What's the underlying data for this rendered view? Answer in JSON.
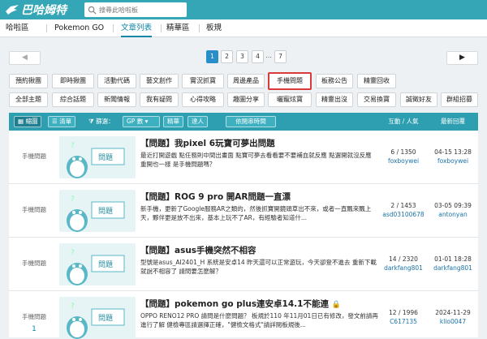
{
  "header": {
    "logo_text": "巴哈姆特",
    "search_placeholder": "搜尋此哈啦板"
  },
  "nav": {
    "tabs": [
      "哈啦區",
      "Pokemon GO",
      "文章列表",
      "精華區",
      "板規"
    ],
    "active_index": 2
  },
  "pager": {
    "prev_label": "◀",
    "next_label": "▶",
    "pages": [
      "1",
      "2",
      "3",
      "4",
      "7"
    ],
    "ellipsis": "…",
    "current": "1"
  },
  "categories_row1": [
    "預約揪團",
    "即時揪團",
    "活動代碼",
    "藝文創作",
    "實況抓寶",
    "周邊產品",
    "手機問題",
    "板務公告",
    "精靈回收"
  ],
  "categories_row2": [
    "全部主題",
    "綜合話題",
    "新聞情報",
    "我有疑問",
    "心得攻略",
    "趣圖分享",
    "曬寵炫寶",
    "精靈出沒",
    "交易換寶",
    "誠徵好友",
    "群組招募"
  ],
  "active_category": "手機問題",
  "listbar": {
    "thumb_view": "縮圖",
    "list_view": "清單",
    "filter_label": "篩選：",
    "gp_select": "GP 數",
    "featured": "精華",
    "hot": "達人",
    "sort": "依閱串時間",
    "col_stats": "互動 / 人氣",
    "col_latest": "最新回覆"
  },
  "posts": [
    {
      "category": "手機問題",
      "thumb_label": "問題",
      "title": "【問題】我pixel 6玩寶可夢出問題",
      "desc": "最近打開遊戲 點任務則中間出畫面 點寶可夢去看看要不要補血就反應 點選開就沒反應 重開也一樣 是手機問題嗎？",
      "stats": "6 / 1350",
      "stats_user": "foxboywei",
      "latest_time": "04-15 13:28",
      "latest_user": "foxboywei",
      "reply_count": ""
    },
    {
      "category": "手機問題",
      "thumb_label": "問題",
      "title": "【問題】ROG 9 pro 開AR問題一直漂",
      "desc": "新手機，更新了Google服務AR之類的，然後抓寶開鏡頭草出不來，或者一直飄來飄上天，夥伴更是放不出來，基本上玩不了AR，有經驗者知道什...",
      "stats": "2 / 1453",
      "stats_user": "asd03100678",
      "latest_time": "03-05 09:39",
      "latest_user": "antonyan",
      "reply_count": ""
    },
    {
      "category": "手機問題",
      "thumb_label": "問題",
      "title": "【問題】asus手機突然不相容",
      "desc": "型號是asus_AI2401_H 系統是安卓14 昨天還可以正常遊玩，今天卻登不進去 重新下載就說不相容了 請問要怎麼解？",
      "stats": "14 / 2320",
      "stats_user": "darkfang801",
      "latest_time": "01-01 18:28",
      "latest_user": "darkfang801",
      "reply_count": ""
    },
    {
      "category": "手機問題",
      "thumb_label": "問題",
      "title": "【問題】pokemon go plus連安卓14.1不能連",
      "desc": "OPPO RENO12 PRO 請問是什麼問題？ 板規於110 年11月01日已有修改，發文前請再進行了解 健檢專區請選擇正確，\"健檢文格式\"請詳閱板規後...",
      "stats": "12 / 1996",
      "stats_user": "C617135",
      "latest_time": "2024-11-29",
      "latest_user": "klio0047",
      "reply_count": "1"
    }
  ],
  "colors": {
    "topbar": "#34a6b5",
    "listbar": "#2e9fb0",
    "active_tab": "#0f86a8",
    "active_page": "#2a8fc8",
    "active_category_border": "#d93a3a"
  }
}
